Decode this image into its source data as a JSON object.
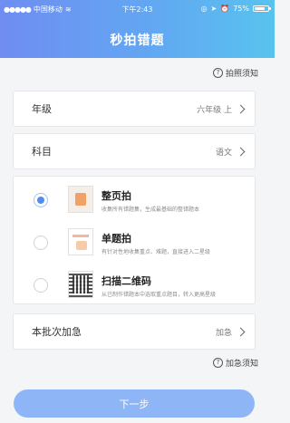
{
  "status_bar": {
    "carrier": "中国移动",
    "time": "下午2:43",
    "battery": "75%",
    "battery_level": 0.75
  },
  "header": {
    "title": "秒拍错题"
  },
  "photo_tips": {
    "label": "拍照须知"
  },
  "grade": {
    "label": "年级",
    "value": "六年级 上"
  },
  "subject": {
    "label": "科目",
    "value": "语文"
  },
  "options": [
    {
      "title": "整页拍",
      "desc": "收集所有错题集，生成最基础的整错题本",
      "selected": true
    },
    {
      "title": "单题拍",
      "desc": "有针对性地收集重点、难题，直接进入二星级",
      "selected": false
    },
    {
      "title": "扫描二维码",
      "desc": "从已制作错题本中选取重点题目，转入更高星级",
      "selected": false
    }
  ],
  "urgent": {
    "label": "本批次加急",
    "value": "加急"
  },
  "urgent_tips": {
    "label": "加急须知"
  },
  "next_button": {
    "label": "下一步"
  }
}
